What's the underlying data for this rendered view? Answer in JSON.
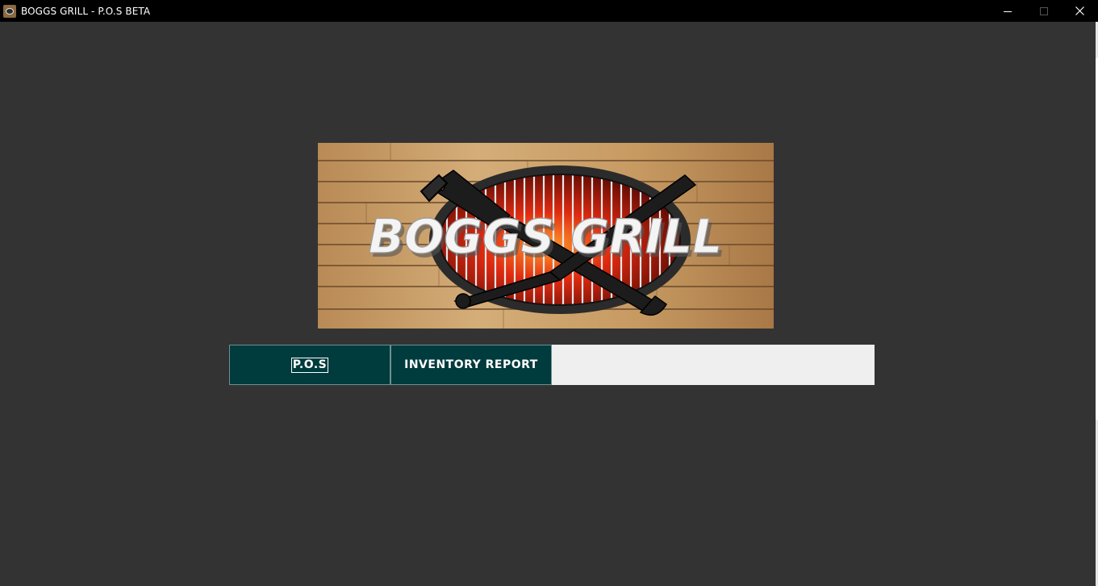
{
  "window": {
    "title": "BOGGS GRILL - P.O.S BETA",
    "controls": [
      "minimize-icon",
      "maximize-icon",
      "close-icon"
    ]
  },
  "logo": {
    "text": "BOGGS GRILL"
  },
  "nav": {
    "pos_label": "P.O.S",
    "inventory_label": "INVENTORY REPORT"
  },
  "colors": {
    "background": "#333333",
    "titlebar": "#000000",
    "button": "#003b3d",
    "button_panel": "#efefef"
  }
}
